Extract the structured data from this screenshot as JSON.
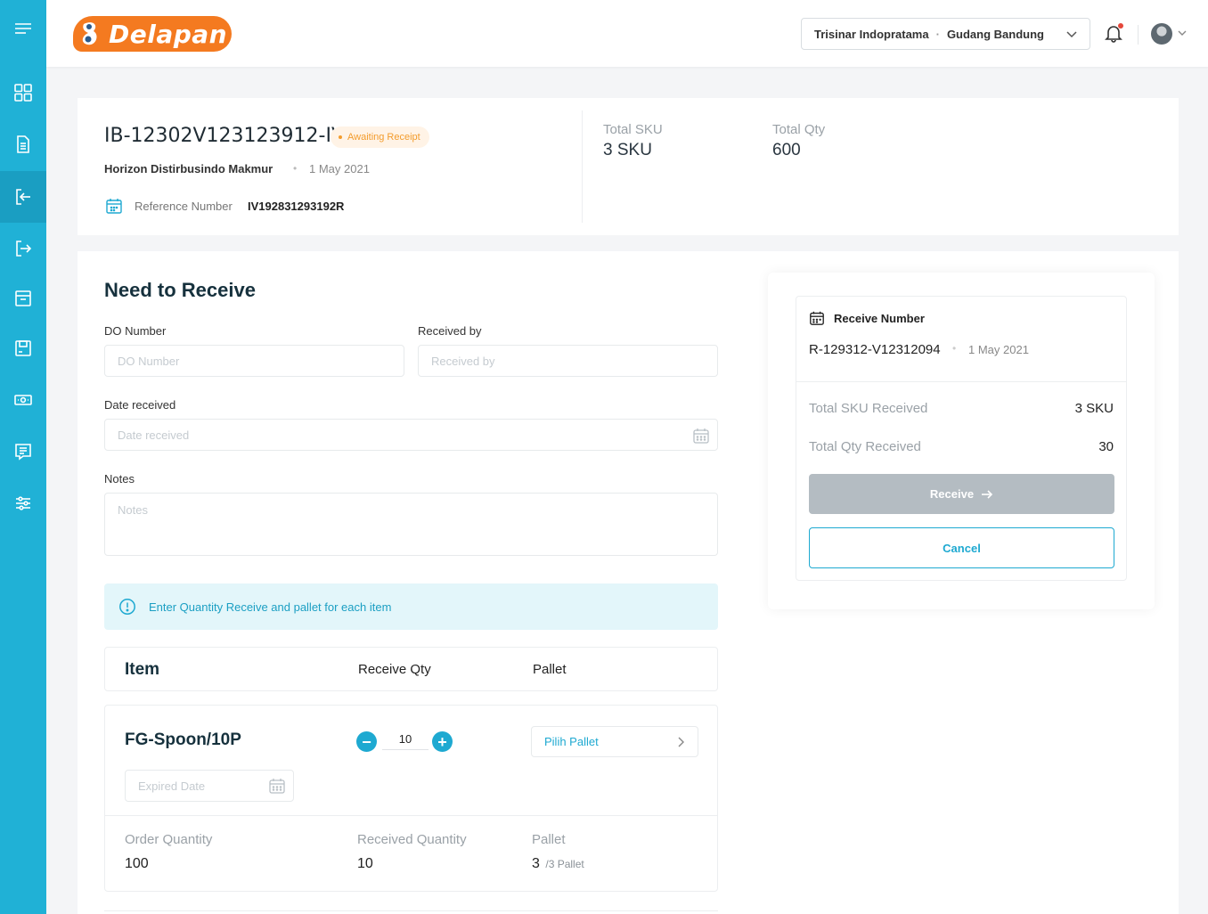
{
  "sidebar": {
    "items": [
      {
        "icon": "menu-icon"
      },
      {
        "icon": "dashboard-icon"
      },
      {
        "icon": "document-icon"
      },
      {
        "icon": "inbound-icon",
        "active": true
      },
      {
        "icon": "outbound-icon"
      },
      {
        "icon": "archive-icon"
      },
      {
        "icon": "inventory-icon"
      },
      {
        "icon": "cash-icon"
      },
      {
        "icon": "report-icon"
      },
      {
        "icon": "settings-icon"
      }
    ]
  },
  "header": {
    "logo_text": "Delapan",
    "company": "Trisinar Indopratama",
    "separator": "·",
    "warehouse": "Gudang Bandung"
  },
  "summary": {
    "doc_id": "IB-12302V123123912-IV",
    "status": "Awaiting Receipt",
    "supplier": "Horizon Distirbusindo Makmur",
    "date": "1 May 2021",
    "reference_label": "Reference Number",
    "reference_value": "IV192831293192R",
    "total_sku_label": "Total SKU",
    "total_sku_value": "3 SKU",
    "total_qty_label": "Total Qty",
    "total_qty_value": "600"
  },
  "form": {
    "title": "Need to Receive",
    "do_number_label": "DO Number",
    "do_number_placeholder": "DO Number",
    "received_by_label": "Received by",
    "received_by_placeholder": "Received by",
    "date_label": "Date received",
    "date_placeholder": "Date received",
    "notes_label": "Notes",
    "notes_placeholder": "Notes",
    "info_text": "Enter Quantity Receive and pallet for each item"
  },
  "table": {
    "headers": {
      "item": "Item",
      "receive_qty": "Receive Qty",
      "pallet": "Pallet"
    },
    "rows": [
      {
        "name": "FG-Spoon/10P",
        "qty": "10",
        "minus": "−",
        "plus": "+",
        "pallet_placeholder": "Pilih Pallet",
        "expired_placeholder": "Expired Date",
        "order_qty_label": "Order Quantity",
        "order_qty": "100",
        "received_qty_label": "Received Quantity",
        "received_qty": "10",
        "pallet_label": "Pallet",
        "pallet_count": "3",
        "pallet_total": "/3 Pallet"
      }
    ]
  },
  "receipt": {
    "title": "Receive Number",
    "number": "R-129312-V12312094",
    "date": "1 May 2021",
    "total_sku_label": "Total SKU Received",
    "total_sku_value": "3 SKU",
    "total_qty_label": "Total Qty Received",
    "total_qty_value": "30",
    "receive_button": "Receive",
    "cancel_button": "Cancel"
  },
  "colors": {
    "primary": "#20b1d6",
    "brand_orange": "#f47a20",
    "status_orange": "#f39c2d",
    "disabled_button": "#b4bcc2"
  }
}
